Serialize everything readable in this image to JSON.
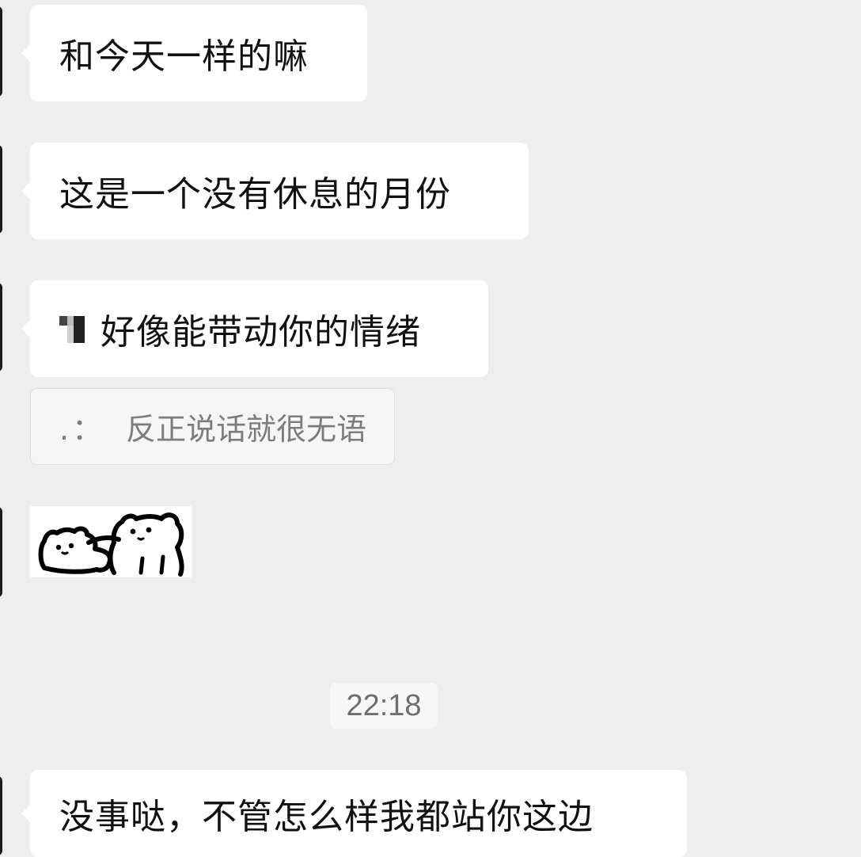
{
  "chat": {
    "messages": [
      {
        "text": "和今天一样的嘛"
      },
      {
        "text": "这是一个没有休息的月份"
      },
      {
        "text": "好像能带动你的情绪"
      },
      {
        "text": "没事哒，不管怎么样我都站你这边"
      }
    ],
    "quote": {
      "prefix": ".：",
      "text": "反正说话就很无语"
    },
    "timestamp": "22:18"
  },
  "colors": {
    "background": "#eeeeee",
    "bubble": "#ffffff",
    "quote_bg": "#f6f6f6",
    "timestamp_text": "#6e6e6e"
  }
}
